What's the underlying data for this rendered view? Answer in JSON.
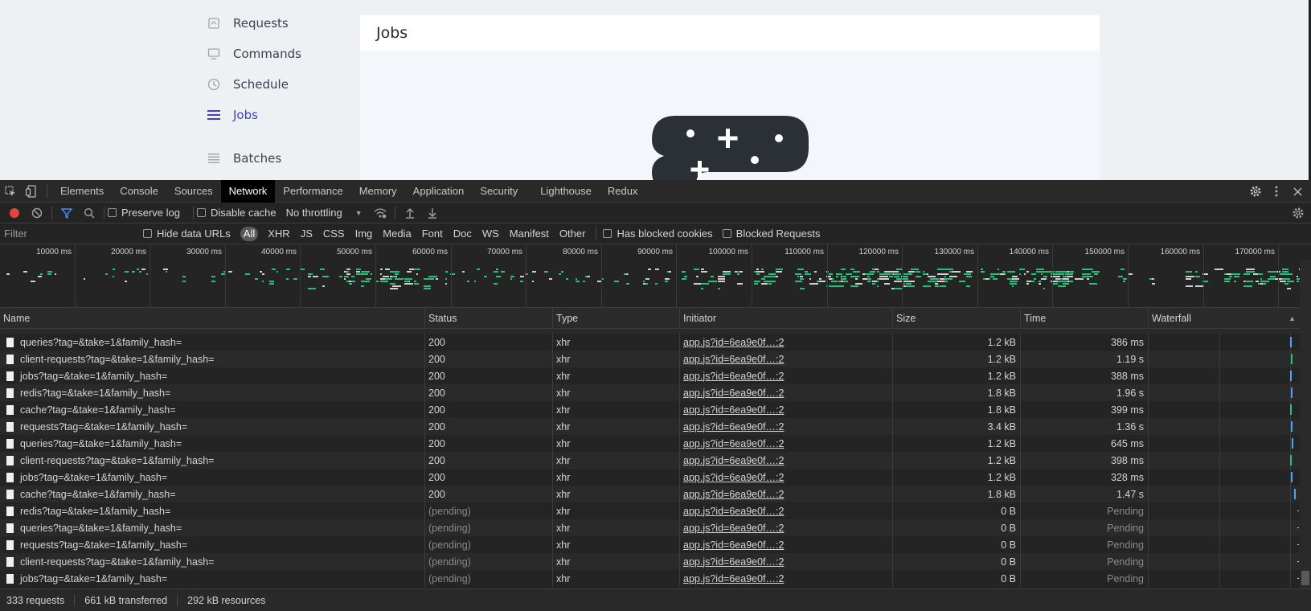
{
  "page": {
    "nav": [
      {
        "label": "Requests",
        "icon": "requests-icon",
        "active": false
      },
      {
        "label": "Commands",
        "icon": "monitor-icon",
        "active": false
      },
      {
        "label": "Schedule",
        "icon": "clock-icon",
        "active": false
      },
      {
        "label": "Jobs",
        "icon": "list-icon",
        "active": true
      },
      {
        "label": "Batches",
        "icon": "stack-icon",
        "active": false
      }
    ],
    "card_title": "Jobs"
  },
  "devtools": {
    "tabs": [
      "Elements",
      "Console",
      "Sources",
      "Network",
      "Performance",
      "Memory",
      "Application",
      "Security",
      "Lighthouse",
      "Redux"
    ],
    "active_tab": "Network",
    "toolbar": {
      "preserve_log": "Preserve log",
      "disable_cache": "Disable cache",
      "throttling": "No throttling"
    },
    "filterbar": {
      "placeholder": "Filter",
      "hide_data_urls": "Hide data URLs",
      "types": [
        "All",
        "XHR",
        "JS",
        "CSS",
        "Img",
        "Media",
        "Font",
        "Doc",
        "WS",
        "Manifest",
        "Other"
      ],
      "active_type": "All",
      "has_blocked_cookies": "Has blocked cookies",
      "blocked_requests": "Blocked Requests"
    },
    "overview_ticks": [
      "10000 ms",
      "20000 ms",
      "30000 ms",
      "40000 ms",
      "50000 ms",
      "60000 ms",
      "70000 ms",
      "80000 ms",
      "90000 ms",
      "100000 ms",
      "110000 ms",
      "120000 ms",
      "130000 ms",
      "140000 ms",
      "150000 ms",
      "160000 ms",
      "170000 ms"
    ],
    "columns": [
      "Name",
      "Status",
      "Type",
      "Initiator",
      "Size",
      "Time",
      "Waterfall"
    ],
    "rows": [
      {
        "name": "queries?tag=&take=1&family_hash=",
        "status": "200",
        "type": "xhr",
        "initiator": "app.js?id=6ea9e0f…:2",
        "size": "1.2 kB",
        "time": "386 ms",
        "pending": false
      },
      {
        "name": "client-requests?tag=&take=1&family_hash=",
        "status": "200",
        "type": "xhr",
        "initiator": "app.js?id=6ea9e0f…:2",
        "size": "1.2 kB",
        "time": "1.19 s",
        "pending": false
      },
      {
        "name": "jobs?tag=&take=1&family_hash=",
        "status": "200",
        "type": "xhr",
        "initiator": "app.js?id=6ea9e0f…:2",
        "size": "1.2 kB",
        "time": "388 ms",
        "pending": false
      },
      {
        "name": "redis?tag=&take=1&family_hash=",
        "status": "200",
        "type": "xhr",
        "initiator": "app.js?id=6ea9e0f…:2",
        "size": "1.8 kB",
        "time": "1.96 s",
        "pending": false
      },
      {
        "name": "cache?tag=&take=1&family_hash=",
        "status": "200",
        "type": "xhr",
        "initiator": "app.js?id=6ea9e0f…:2",
        "size": "1.8 kB",
        "time": "399 ms",
        "pending": false
      },
      {
        "name": "requests?tag=&take=1&family_hash=",
        "status": "200",
        "type": "xhr",
        "initiator": "app.js?id=6ea9e0f…:2",
        "size": "3.4 kB",
        "time": "1.36 s",
        "pending": false
      },
      {
        "name": "queries?tag=&take=1&family_hash=",
        "status": "200",
        "type": "xhr",
        "initiator": "app.js?id=6ea9e0f…:2",
        "size": "1.2 kB",
        "time": "645 ms",
        "pending": false
      },
      {
        "name": "client-requests?tag=&take=1&family_hash=",
        "status": "200",
        "type": "xhr",
        "initiator": "app.js?id=6ea9e0f…:2",
        "size": "1.2 kB",
        "time": "398 ms",
        "pending": false
      },
      {
        "name": "jobs?tag=&take=1&family_hash=",
        "status": "200",
        "type": "xhr",
        "initiator": "app.js?id=6ea9e0f…:2",
        "size": "1.2 kB",
        "time": "328 ms",
        "pending": false
      },
      {
        "name": "cache?tag=&take=1&family_hash=",
        "status": "200",
        "type": "xhr",
        "initiator": "app.js?id=6ea9e0f…:2",
        "size": "1.8 kB",
        "time": "1.47 s",
        "pending": false
      },
      {
        "name": "redis?tag=&take=1&family_hash=",
        "status": "(pending)",
        "type": "xhr",
        "initiator": "app.js?id=6ea9e0f…:2",
        "size": "0 B",
        "time": "Pending",
        "pending": true
      },
      {
        "name": "queries?tag=&take=1&family_hash=",
        "status": "(pending)",
        "type": "xhr",
        "initiator": "app.js?id=6ea9e0f…:2",
        "size": "0 B",
        "time": "Pending",
        "pending": true
      },
      {
        "name": "requests?tag=&take=1&family_hash=",
        "status": "(pending)",
        "type": "xhr",
        "initiator": "app.js?id=6ea9e0f…:2",
        "size": "0 B",
        "time": "Pending",
        "pending": true
      },
      {
        "name": "client-requests?tag=&take=1&family_hash=",
        "status": "(pending)",
        "type": "xhr",
        "initiator": "app.js?id=6ea9e0f…:2",
        "size": "0 B",
        "time": "Pending",
        "pending": true
      },
      {
        "name": "jobs?tag=&take=1&family_hash=",
        "status": "(pending)",
        "type": "xhr",
        "initiator": "app.js?id=6ea9e0f…:2",
        "size": "0 B",
        "time": "Pending",
        "pending": true
      }
    ],
    "status": {
      "requests": "333 requests",
      "transferred": "661 kB transferred",
      "resources": "292 kB resources"
    },
    "colors": {
      "waterfall_blue": "#4fa3ff",
      "waterfall_green": "#23c27a",
      "record_red": "#e0453f",
      "filter_blue": "#4a8ff0",
      "active_nav": "#4040c0"
    }
  }
}
